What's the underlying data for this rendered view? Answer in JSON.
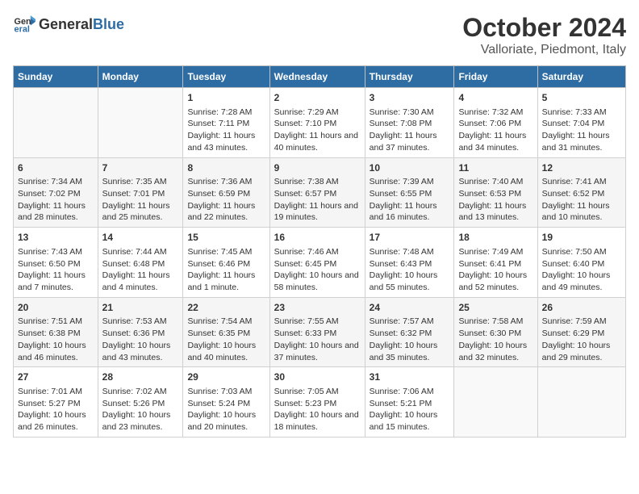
{
  "header": {
    "logo_general": "General",
    "logo_blue": "Blue",
    "month_title": "October 2024",
    "location": "Valloriate, Piedmont, Italy"
  },
  "days_of_week": [
    "Sunday",
    "Monday",
    "Tuesday",
    "Wednesday",
    "Thursday",
    "Friday",
    "Saturday"
  ],
  "weeks": [
    [
      {
        "day": "",
        "sunrise": "",
        "sunset": "",
        "daylight": ""
      },
      {
        "day": "",
        "sunrise": "",
        "sunset": "",
        "daylight": ""
      },
      {
        "day": "1",
        "sunrise": "Sunrise: 7:28 AM",
        "sunset": "Sunset: 7:11 PM",
        "daylight": "Daylight: 11 hours and 43 minutes."
      },
      {
        "day": "2",
        "sunrise": "Sunrise: 7:29 AM",
        "sunset": "Sunset: 7:10 PM",
        "daylight": "Daylight: 11 hours and 40 minutes."
      },
      {
        "day": "3",
        "sunrise": "Sunrise: 7:30 AM",
        "sunset": "Sunset: 7:08 PM",
        "daylight": "Daylight: 11 hours and 37 minutes."
      },
      {
        "day": "4",
        "sunrise": "Sunrise: 7:32 AM",
        "sunset": "Sunset: 7:06 PM",
        "daylight": "Daylight: 11 hours and 34 minutes."
      },
      {
        "day": "5",
        "sunrise": "Sunrise: 7:33 AM",
        "sunset": "Sunset: 7:04 PM",
        "daylight": "Daylight: 11 hours and 31 minutes."
      }
    ],
    [
      {
        "day": "6",
        "sunrise": "Sunrise: 7:34 AM",
        "sunset": "Sunset: 7:02 PM",
        "daylight": "Daylight: 11 hours and 28 minutes."
      },
      {
        "day": "7",
        "sunrise": "Sunrise: 7:35 AM",
        "sunset": "Sunset: 7:01 PM",
        "daylight": "Daylight: 11 hours and 25 minutes."
      },
      {
        "day": "8",
        "sunrise": "Sunrise: 7:36 AM",
        "sunset": "Sunset: 6:59 PM",
        "daylight": "Daylight: 11 hours and 22 minutes."
      },
      {
        "day": "9",
        "sunrise": "Sunrise: 7:38 AM",
        "sunset": "Sunset: 6:57 PM",
        "daylight": "Daylight: 11 hours and 19 minutes."
      },
      {
        "day": "10",
        "sunrise": "Sunrise: 7:39 AM",
        "sunset": "Sunset: 6:55 PM",
        "daylight": "Daylight: 11 hours and 16 minutes."
      },
      {
        "day": "11",
        "sunrise": "Sunrise: 7:40 AM",
        "sunset": "Sunset: 6:53 PM",
        "daylight": "Daylight: 11 hours and 13 minutes."
      },
      {
        "day": "12",
        "sunrise": "Sunrise: 7:41 AM",
        "sunset": "Sunset: 6:52 PM",
        "daylight": "Daylight: 11 hours and 10 minutes."
      }
    ],
    [
      {
        "day": "13",
        "sunrise": "Sunrise: 7:43 AM",
        "sunset": "Sunset: 6:50 PM",
        "daylight": "Daylight: 11 hours and 7 minutes."
      },
      {
        "day": "14",
        "sunrise": "Sunrise: 7:44 AM",
        "sunset": "Sunset: 6:48 PM",
        "daylight": "Daylight: 11 hours and 4 minutes."
      },
      {
        "day": "15",
        "sunrise": "Sunrise: 7:45 AM",
        "sunset": "Sunset: 6:46 PM",
        "daylight": "Daylight: 11 hours and 1 minute."
      },
      {
        "day": "16",
        "sunrise": "Sunrise: 7:46 AM",
        "sunset": "Sunset: 6:45 PM",
        "daylight": "Daylight: 10 hours and 58 minutes."
      },
      {
        "day": "17",
        "sunrise": "Sunrise: 7:48 AM",
        "sunset": "Sunset: 6:43 PM",
        "daylight": "Daylight: 10 hours and 55 minutes."
      },
      {
        "day": "18",
        "sunrise": "Sunrise: 7:49 AM",
        "sunset": "Sunset: 6:41 PM",
        "daylight": "Daylight: 10 hours and 52 minutes."
      },
      {
        "day": "19",
        "sunrise": "Sunrise: 7:50 AM",
        "sunset": "Sunset: 6:40 PM",
        "daylight": "Daylight: 10 hours and 49 minutes."
      }
    ],
    [
      {
        "day": "20",
        "sunrise": "Sunrise: 7:51 AM",
        "sunset": "Sunset: 6:38 PM",
        "daylight": "Daylight: 10 hours and 46 minutes."
      },
      {
        "day": "21",
        "sunrise": "Sunrise: 7:53 AM",
        "sunset": "Sunset: 6:36 PM",
        "daylight": "Daylight: 10 hours and 43 minutes."
      },
      {
        "day": "22",
        "sunrise": "Sunrise: 7:54 AM",
        "sunset": "Sunset: 6:35 PM",
        "daylight": "Daylight: 10 hours and 40 minutes."
      },
      {
        "day": "23",
        "sunrise": "Sunrise: 7:55 AM",
        "sunset": "Sunset: 6:33 PM",
        "daylight": "Daylight: 10 hours and 37 minutes."
      },
      {
        "day": "24",
        "sunrise": "Sunrise: 7:57 AM",
        "sunset": "Sunset: 6:32 PM",
        "daylight": "Daylight: 10 hours and 35 minutes."
      },
      {
        "day": "25",
        "sunrise": "Sunrise: 7:58 AM",
        "sunset": "Sunset: 6:30 PM",
        "daylight": "Daylight: 10 hours and 32 minutes."
      },
      {
        "day": "26",
        "sunrise": "Sunrise: 7:59 AM",
        "sunset": "Sunset: 6:29 PM",
        "daylight": "Daylight: 10 hours and 29 minutes."
      }
    ],
    [
      {
        "day": "27",
        "sunrise": "Sunrise: 7:01 AM",
        "sunset": "Sunset: 5:27 PM",
        "daylight": "Daylight: 10 hours and 26 minutes."
      },
      {
        "day": "28",
        "sunrise": "Sunrise: 7:02 AM",
        "sunset": "Sunset: 5:26 PM",
        "daylight": "Daylight: 10 hours and 23 minutes."
      },
      {
        "day": "29",
        "sunrise": "Sunrise: 7:03 AM",
        "sunset": "Sunset: 5:24 PM",
        "daylight": "Daylight: 10 hours and 20 minutes."
      },
      {
        "day": "30",
        "sunrise": "Sunrise: 7:05 AM",
        "sunset": "Sunset: 5:23 PM",
        "daylight": "Daylight: 10 hours and 18 minutes."
      },
      {
        "day": "31",
        "sunrise": "Sunrise: 7:06 AM",
        "sunset": "Sunset: 5:21 PM",
        "daylight": "Daylight: 10 hours and 15 minutes."
      },
      {
        "day": "",
        "sunrise": "",
        "sunset": "",
        "daylight": ""
      },
      {
        "day": "",
        "sunrise": "",
        "sunset": "",
        "daylight": ""
      }
    ]
  ]
}
